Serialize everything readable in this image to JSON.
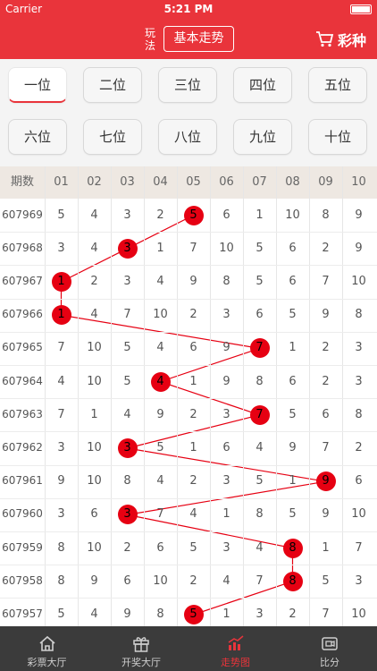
{
  "status": {
    "carrier": "Carrier",
    "time": "5:21 PM"
  },
  "nav": {
    "play_label": "玩法",
    "trend_button": "基本走势",
    "brand": "彩种"
  },
  "positions": [
    "一位",
    "二位",
    "三位",
    "四位",
    "五位",
    "六位",
    "七位",
    "八位",
    "九位",
    "十位"
  ],
  "selected_position": "一位",
  "table": {
    "issue_header": "期数",
    "columns": [
      "01",
      "02",
      "03",
      "04",
      "05",
      "06",
      "07",
      "08",
      "09",
      "10"
    ],
    "rows": [
      {
        "issue": "607969",
        "values": [
          "5",
          "4",
          "3",
          "2",
          "5",
          "6",
          "1",
          "10",
          "8",
          "9"
        ],
        "hit_col": 4
      },
      {
        "issue": "607968",
        "values": [
          "3",
          "4",
          "3",
          "1",
          "7",
          "10",
          "5",
          "6",
          "2",
          "9"
        ],
        "hit_col": 2
      },
      {
        "issue": "607967",
        "values": [
          "1",
          "2",
          "3",
          "4",
          "9",
          "8",
          "5",
          "6",
          "7",
          "10"
        ],
        "hit_col": 0
      },
      {
        "issue": "607966",
        "values": [
          "1",
          "4",
          "7",
          "10",
          "2",
          "3",
          "6",
          "5",
          "9",
          "8"
        ],
        "hit_col": 0
      },
      {
        "issue": "607965",
        "values": [
          "7",
          "10",
          "5",
          "4",
          "6",
          "9",
          "7",
          "1",
          "2",
          "3"
        ],
        "hit_col": 6
      },
      {
        "issue": "607964",
        "values": [
          "4",
          "10",
          "5",
          "4",
          "1",
          "9",
          "8",
          "6",
          "2",
          "3"
        ],
        "hit_col": 3
      },
      {
        "issue": "607963",
        "values": [
          "7",
          "1",
          "4",
          "9",
          "2",
          "3",
          "7",
          "5",
          "6",
          "8"
        ],
        "hit_col": 6
      },
      {
        "issue": "607962",
        "values": [
          "3",
          "10",
          "3",
          "5",
          "1",
          "6",
          "4",
          "9",
          "7",
          "2"
        ],
        "hit_col": 2
      },
      {
        "issue": "607961",
        "values": [
          "9",
          "10",
          "8",
          "4",
          "2",
          "3",
          "5",
          "1",
          "9",
          "6"
        ],
        "hit_col": 8
      },
      {
        "issue": "607960",
        "values": [
          "3",
          "6",
          "3",
          "7",
          "4",
          "1",
          "8",
          "5",
          "9",
          "10"
        ],
        "hit_col": 2
      },
      {
        "issue": "607959",
        "values": [
          "8",
          "10",
          "2",
          "6",
          "5",
          "3",
          "4",
          "8",
          "1",
          "7"
        ],
        "hit_col": 7
      },
      {
        "issue": "607958",
        "values": [
          "8",
          "9",
          "6",
          "10",
          "2",
          "4",
          "7",
          "8",
          "5",
          "3"
        ],
        "hit_col": 7
      },
      {
        "issue": "607957",
        "values": [
          "5",
          "4",
          "9",
          "8",
          "5",
          "1",
          "3",
          "2",
          "7",
          "10"
        ],
        "hit_col": 4
      }
    ]
  },
  "tabs": [
    {
      "label": "彩票大厅",
      "icon": "home-icon"
    },
    {
      "label": "开奖大厅",
      "icon": "gift-icon"
    },
    {
      "label": "走势图",
      "icon": "chart-icon"
    },
    {
      "label": "比分",
      "icon": "score-icon"
    }
  ],
  "active_tab": "走势图",
  "colors": {
    "accent": "#e9343b",
    "ball": "#e60012",
    "tabbar": "#3b3b3b"
  }
}
